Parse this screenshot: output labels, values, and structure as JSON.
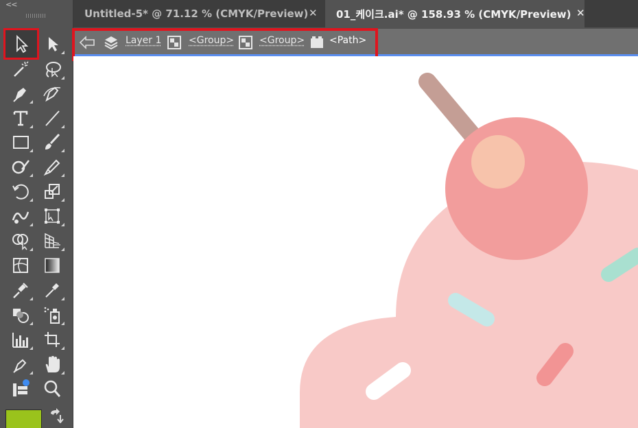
{
  "toolbar": {
    "collapse_glyph": "<<",
    "tools": [
      {
        "name": "selection-tool",
        "icon": "selection-arrow-icon"
      },
      {
        "name": "direct-selection-tool",
        "icon": "direct-selection-arrow-icon"
      },
      {
        "name": "magic-wand-tool",
        "icon": "magic-wand-icon"
      },
      {
        "name": "lasso-tool",
        "icon": "lasso-icon"
      },
      {
        "name": "pen-tool",
        "icon": "pen-icon"
      },
      {
        "name": "curvature-tool",
        "icon": "curvature-pen-icon"
      },
      {
        "name": "type-tool",
        "icon": "type-icon"
      },
      {
        "name": "line-segment-tool",
        "icon": "line-icon"
      },
      {
        "name": "rectangle-tool",
        "icon": "rectangle-icon"
      },
      {
        "name": "paintbrush-tool",
        "icon": "paintbrush-icon"
      },
      {
        "name": "shaper-tool",
        "icon": "shaper-icon"
      },
      {
        "name": "eraser-tool",
        "icon": "eraser-icon"
      },
      {
        "name": "rotate-tool",
        "icon": "rotate-icon"
      },
      {
        "name": "scale-tool",
        "icon": "scale-icon"
      },
      {
        "name": "warp-tool",
        "icon": "warp-icon"
      },
      {
        "name": "free-transform-tool",
        "icon": "free-transform-icon"
      },
      {
        "name": "shape-builder-tool",
        "icon": "shape-builder-icon"
      },
      {
        "name": "perspective-grid-tool",
        "icon": "perspective-grid-icon"
      },
      {
        "name": "mesh-tool",
        "icon": "mesh-icon"
      },
      {
        "name": "gradient-tool",
        "icon": "gradient-icon"
      },
      {
        "name": "blend-tool",
        "icon": "blend-icon"
      },
      {
        "name": "eyedropper-tool",
        "icon": "eyedropper-icon"
      },
      {
        "name": "live-paint-bucket-tool",
        "icon": "live-paint-icon"
      },
      {
        "name": "symbol-sprayer-tool",
        "icon": "symbol-sprayer-icon"
      },
      {
        "name": "column-graph-tool",
        "icon": "column-graph-icon"
      },
      {
        "name": "artboard-tool",
        "icon": "artboard-icon"
      },
      {
        "name": "puppet-warp-tool",
        "icon": "puppet-pen-icon"
      },
      {
        "name": "hand-tool",
        "icon": "hand-icon"
      },
      {
        "name": "edit-toolbar",
        "icon": "edit-toolbar-icon"
      },
      {
        "name": "zoom-tool",
        "icon": "zoom-icon"
      }
    ],
    "fill_color": "#9ac31c",
    "swap_icon": "swap-arrow-icon"
  },
  "tabs": [
    {
      "label": "Untitled-5* @ 71.12 % (CMYK/Preview)",
      "close": "✕",
      "active": false
    },
    {
      "label": "01_케이크.ai* @ 158.93 % (CMYK/Preview)",
      "close": "✕",
      "active": true
    }
  ],
  "breadcrumb": {
    "back_icon": "back-arrow-icon",
    "items": [
      {
        "icon": "layers-icon",
        "label": "Layer 1"
      },
      {
        "icon": "group-icon",
        "label": "<Group>"
      },
      {
        "icon": "group-icon",
        "label": "<Group>"
      },
      {
        "icon": "path-icon",
        "label": "<Path>"
      }
    ]
  },
  "colors": {
    "accent_line": "#5b8ef0",
    "highlight": "#e0141e",
    "cake": "#f8c9c7",
    "cherry": "#f29d9c",
    "cherry_highlight": "#f7c3ab",
    "stem": "#c49e95",
    "sprinkle_mint": "#a9e0d0",
    "sprinkle_blue": "#c4e8e8",
    "sprinkle_red": "#f29494",
    "sprinkle_white": "#ffffff"
  }
}
